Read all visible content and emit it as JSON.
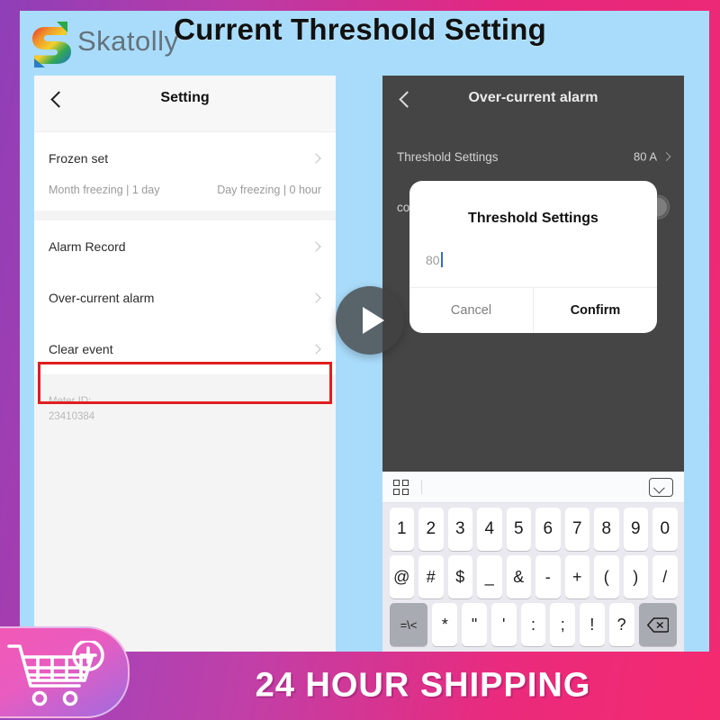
{
  "hero": {
    "title": "Current Threshold Setting",
    "watermark": "Skatolly",
    "logo_icon": "skatolly-s-logo-icon"
  },
  "left_phone": {
    "back_icon": "chevron-left-icon",
    "title": "Setting",
    "rows": [
      {
        "label": "Frozen set",
        "chevron_icon": "chevron-right-icon"
      },
      {
        "label": "Alarm Record",
        "chevron_icon": "chevron-right-icon"
      },
      {
        "label": "Over-current alarm",
        "chevron_icon": "chevron-right-icon"
      },
      {
        "label": "Clear event",
        "chevron_icon": "chevron-right-icon"
      }
    ],
    "freeze_info": {
      "month": "Month freezing | 1 day",
      "day": "Day freezing | 0 hour"
    },
    "meter_id_label": "Meter ID:",
    "meter_id_value": "23410384",
    "highlight_color": "#e01f1f"
  },
  "right_phone": {
    "back_icon": "chevron-left-icon",
    "title": "Over-current alarm",
    "rows": [
      {
        "label": "Threshold Settings",
        "value": "80 A",
        "chevron_icon": "chevron-right-icon"
      },
      {
        "label": "co",
        "toggle_icon": "toggle-switch-off-icon"
      }
    ],
    "dialog": {
      "title": "Threshold Settings",
      "input_value": "80",
      "cancel_label": "Cancel",
      "confirm_label": "Confirm"
    },
    "keyboard": {
      "grid_icon": "keyboard-grid-icon",
      "hide_icon": "hide-keyboard-chevron-down-icon",
      "row_numbers": [
        "1",
        "2",
        "3",
        "4",
        "5",
        "6",
        "7",
        "8",
        "9",
        "0"
      ],
      "row_symbols": [
        "@",
        "#",
        "$",
        "_",
        "&",
        "-",
        "+",
        "(",
        ")",
        "/"
      ],
      "row_extra_left_label": "=\\<",
      "row_extra": [
        "*",
        "\"",
        "'",
        ":",
        ";",
        "!",
        "?"
      ],
      "backspace_icon": "backspace-icon"
    }
  },
  "overlay": {
    "play_icon": "play-button-icon"
  },
  "banner": {
    "text": "24 HOUR SHIPPING",
    "cart_icon": "add-to-cart-icon"
  },
  "colors": {
    "frame": "#e5277f",
    "canvas": "#a9dcfb",
    "highlight": "#e01f1f",
    "accent_caret": "#2f6fd0"
  }
}
